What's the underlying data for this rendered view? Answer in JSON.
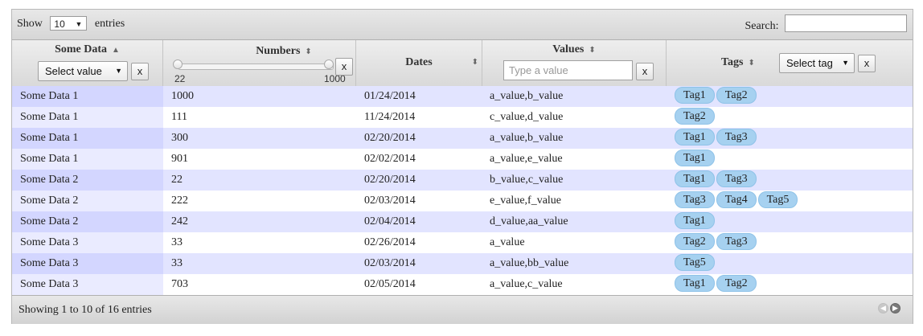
{
  "toolbar": {
    "show_label": "Show",
    "entries_label": "entries",
    "page_length": "10",
    "search_label": "Search:",
    "search_value": ""
  },
  "columns": [
    {
      "title": "Some Data",
      "sort": "asc"
    },
    {
      "title": "Numbers",
      "sort": "both"
    },
    {
      "title": "Dates",
      "sort": "both"
    },
    {
      "title": "Values",
      "sort": "both"
    },
    {
      "title": "Tags",
      "sort": "both"
    }
  ],
  "filters": {
    "some_data_select": "Select value",
    "clear_label": "x",
    "numbers_min": "22",
    "numbers_max": "1000",
    "values_placeholder": "Type a value",
    "tags_select": "Select tag"
  },
  "rows": [
    {
      "some_data": "Some Data 1",
      "number": "1000",
      "date": "01/24/2014",
      "values": "a_value,b_value",
      "tags": [
        "Tag1",
        "Tag2"
      ]
    },
    {
      "some_data": "Some Data 1",
      "number": "111",
      "date": "11/24/2014",
      "values": "c_value,d_value",
      "tags": [
        "Tag2"
      ]
    },
    {
      "some_data": "Some Data 1",
      "number": "300",
      "date": "02/20/2014",
      "values": "a_value,b_value",
      "tags": [
        "Tag1",
        "Tag3"
      ]
    },
    {
      "some_data": "Some Data 1",
      "number": "901",
      "date": "02/02/2014",
      "values": "a_value,e_value",
      "tags": [
        "Tag1"
      ]
    },
    {
      "some_data": "Some Data 2",
      "number": "22",
      "date": "02/20/2014",
      "values": "b_value,c_value",
      "tags": [
        "Tag1",
        "Tag3"
      ]
    },
    {
      "some_data": "Some Data 2",
      "number": "222",
      "date": "02/03/2014",
      "values": "e_value,f_value",
      "tags": [
        "Tag3",
        "Tag4",
        "Tag5"
      ]
    },
    {
      "some_data": "Some Data 2",
      "number": "242",
      "date": "02/04/2014",
      "values": "d_value,aa_value",
      "tags": [
        "Tag1"
      ]
    },
    {
      "some_data": "Some Data 3",
      "number": "33",
      "date": "02/26/2014",
      "values": "a_value",
      "tags": [
        "Tag2",
        "Tag3"
      ]
    },
    {
      "some_data": "Some Data 3",
      "number": "33",
      "date": "02/03/2014",
      "values": "a_value,bb_value",
      "tags": [
        "Tag5"
      ]
    },
    {
      "some_data": "Some Data 3",
      "number": "703",
      "date": "02/05/2014",
      "values": "a_value,c_value",
      "tags": [
        "Tag1",
        "Tag2"
      ]
    }
  ],
  "footer": {
    "info": "Showing 1 to 10 of 16 entries"
  },
  "icons": {
    "sort_asc": "caret-up-icon",
    "sort_both": "sort-icon",
    "dropdown": "triangle-down-icon",
    "prev": "arrow-left-circle-icon",
    "next": "arrow-right-circle-icon"
  },
  "colors": {
    "row_odd": "#e2e4ff",
    "row_even": "#ffffff",
    "sorted_col_odd": "#d3d6ff",
    "sorted_col_even": "#eaebff",
    "tag_bg": "#a6d1f0"
  }
}
